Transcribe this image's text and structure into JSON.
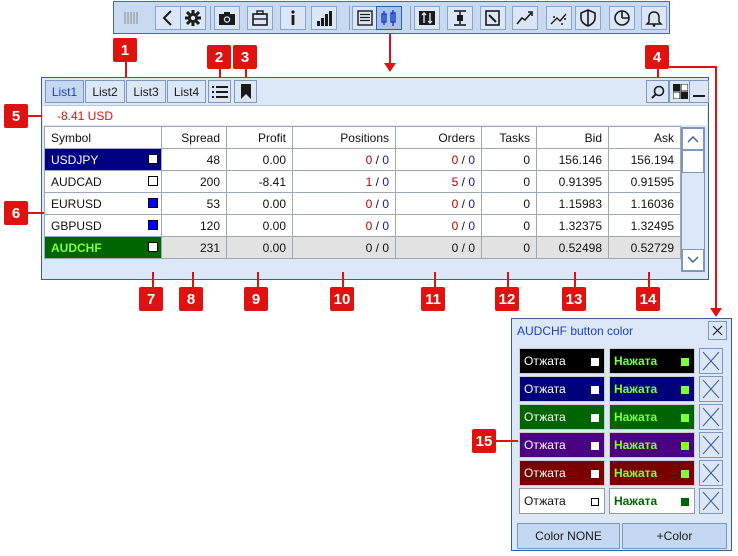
{
  "toolbar": {
    "icons": [
      "grip-icon",
      "back-icon",
      "gear-icon",
      "camera-icon",
      "briefcase-icon",
      "info-icon",
      "signal-bars-icon",
      "list-lines-icon",
      "candles-icon",
      "swap-icon",
      "range-icon",
      "notepad-icon",
      "trend-up-icon",
      "trend-scatter-icon",
      "shield-icon",
      "pie-clock-icon",
      "bell-icon"
    ]
  },
  "tabs": [
    "List1",
    "List2",
    "List3",
    "List4"
  ],
  "pl_text": "-8.41 USD",
  "columns": [
    "Symbol",
    "Spread",
    "Profit",
    "Positions",
    "Orders",
    "Tasks",
    "Bid",
    "Ask"
  ],
  "rows": [
    {
      "symbol": "USDJPY",
      "spread": "48",
      "profit": "0.00",
      "pos_a": "0",
      "pos_b": "0",
      "ord_a": "0",
      "ord_b": "0",
      "tasks": "0",
      "bid": "156.146",
      "ask": "156.194",
      "sym_bg": "#000080",
      "sym_fg": "#ffffff",
      "swatch": "#ffffff"
    },
    {
      "symbol": "AUDCAD",
      "spread": "200",
      "profit": "-8.41",
      "pos_a": "1",
      "pos_b": "0",
      "ord_a": "5",
      "ord_b": "0",
      "tasks": "0",
      "bid": "0.91395",
      "ask": "0.91595",
      "sym_bg": "#ffffff",
      "sym_fg": "#111111",
      "swatch": "#ffffff"
    },
    {
      "symbol": "EURUSD",
      "spread": "53",
      "profit": "0.00",
      "pos_a": "0",
      "pos_b": "0",
      "ord_a": "0",
      "ord_b": "0",
      "tasks": "0",
      "bid": "1.15983",
      "ask": "1.16036",
      "sym_bg": "#ffffff",
      "sym_fg": "#111111",
      "swatch": "#0000ff"
    },
    {
      "symbol": "GBPUSD",
      "spread": "120",
      "profit": "0.00",
      "pos_a": "0",
      "pos_b": "0",
      "ord_a": "0",
      "ord_b": "0",
      "tasks": "0",
      "bid": "1.32375",
      "ask": "1.32495",
      "sym_bg": "#ffffff",
      "sym_fg": "#111111",
      "swatch": "#0000ff"
    },
    {
      "symbol": "AUDCHF",
      "spread": "231",
      "profit": "0.00",
      "pos_a": "0",
      "pos_b": "0",
      "ord_a": "0",
      "ord_b": "0",
      "tasks": "0",
      "bid": "0.52498",
      "ask": "0.52729",
      "sym_bg": "#006400",
      "sym_fg": "#7dff3a",
      "swatch": "#ffffff"
    }
  ],
  "dialog": {
    "title": "AUDCHF button color",
    "released_label": "Отжата",
    "pressed_label": "Нажата",
    "rows": [
      {
        "bg": "#000000",
        "fg": "#ffffff",
        "pressed_fg": "#7dff3a"
      },
      {
        "bg": "#00007a",
        "fg": "#ffffff",
        "pressed_fg": "#7dff3a"
      },
      {
        "bg": "#006400",
        "fg": "#ffffff",
        "pressed_fg": "#7dff3a"
      },
      {
        "bg": "#4b0082",
        "fg": "#ffffff",
        "pressed_fg": "#7dff3a"
      },
      {
        "bg": "#7a0000",
        "fg": "#ffffff",
        "pressed_fg": "#7dff3a"
      },
      {
        "bg": "#ffffff",
        "fg": "#111111",
        "pressed_fg": "#006400"
      }
    ],
    "btn_none": "Color NONE",
    "btn_add": "+Color"
  },
  "annotations": [
    "1",
    "2",
    "3",
    "4",
    "5",
    "6",
    "7",
    "8",
    "9",
    "10",
    "11",
    "12",
    "13",
    "14",
    "15"
  ],
  "colors": {
    "accent": "#e0120f",
    "panel": "#dce8f7",
    "border": "#3a5f92"
  }
}
